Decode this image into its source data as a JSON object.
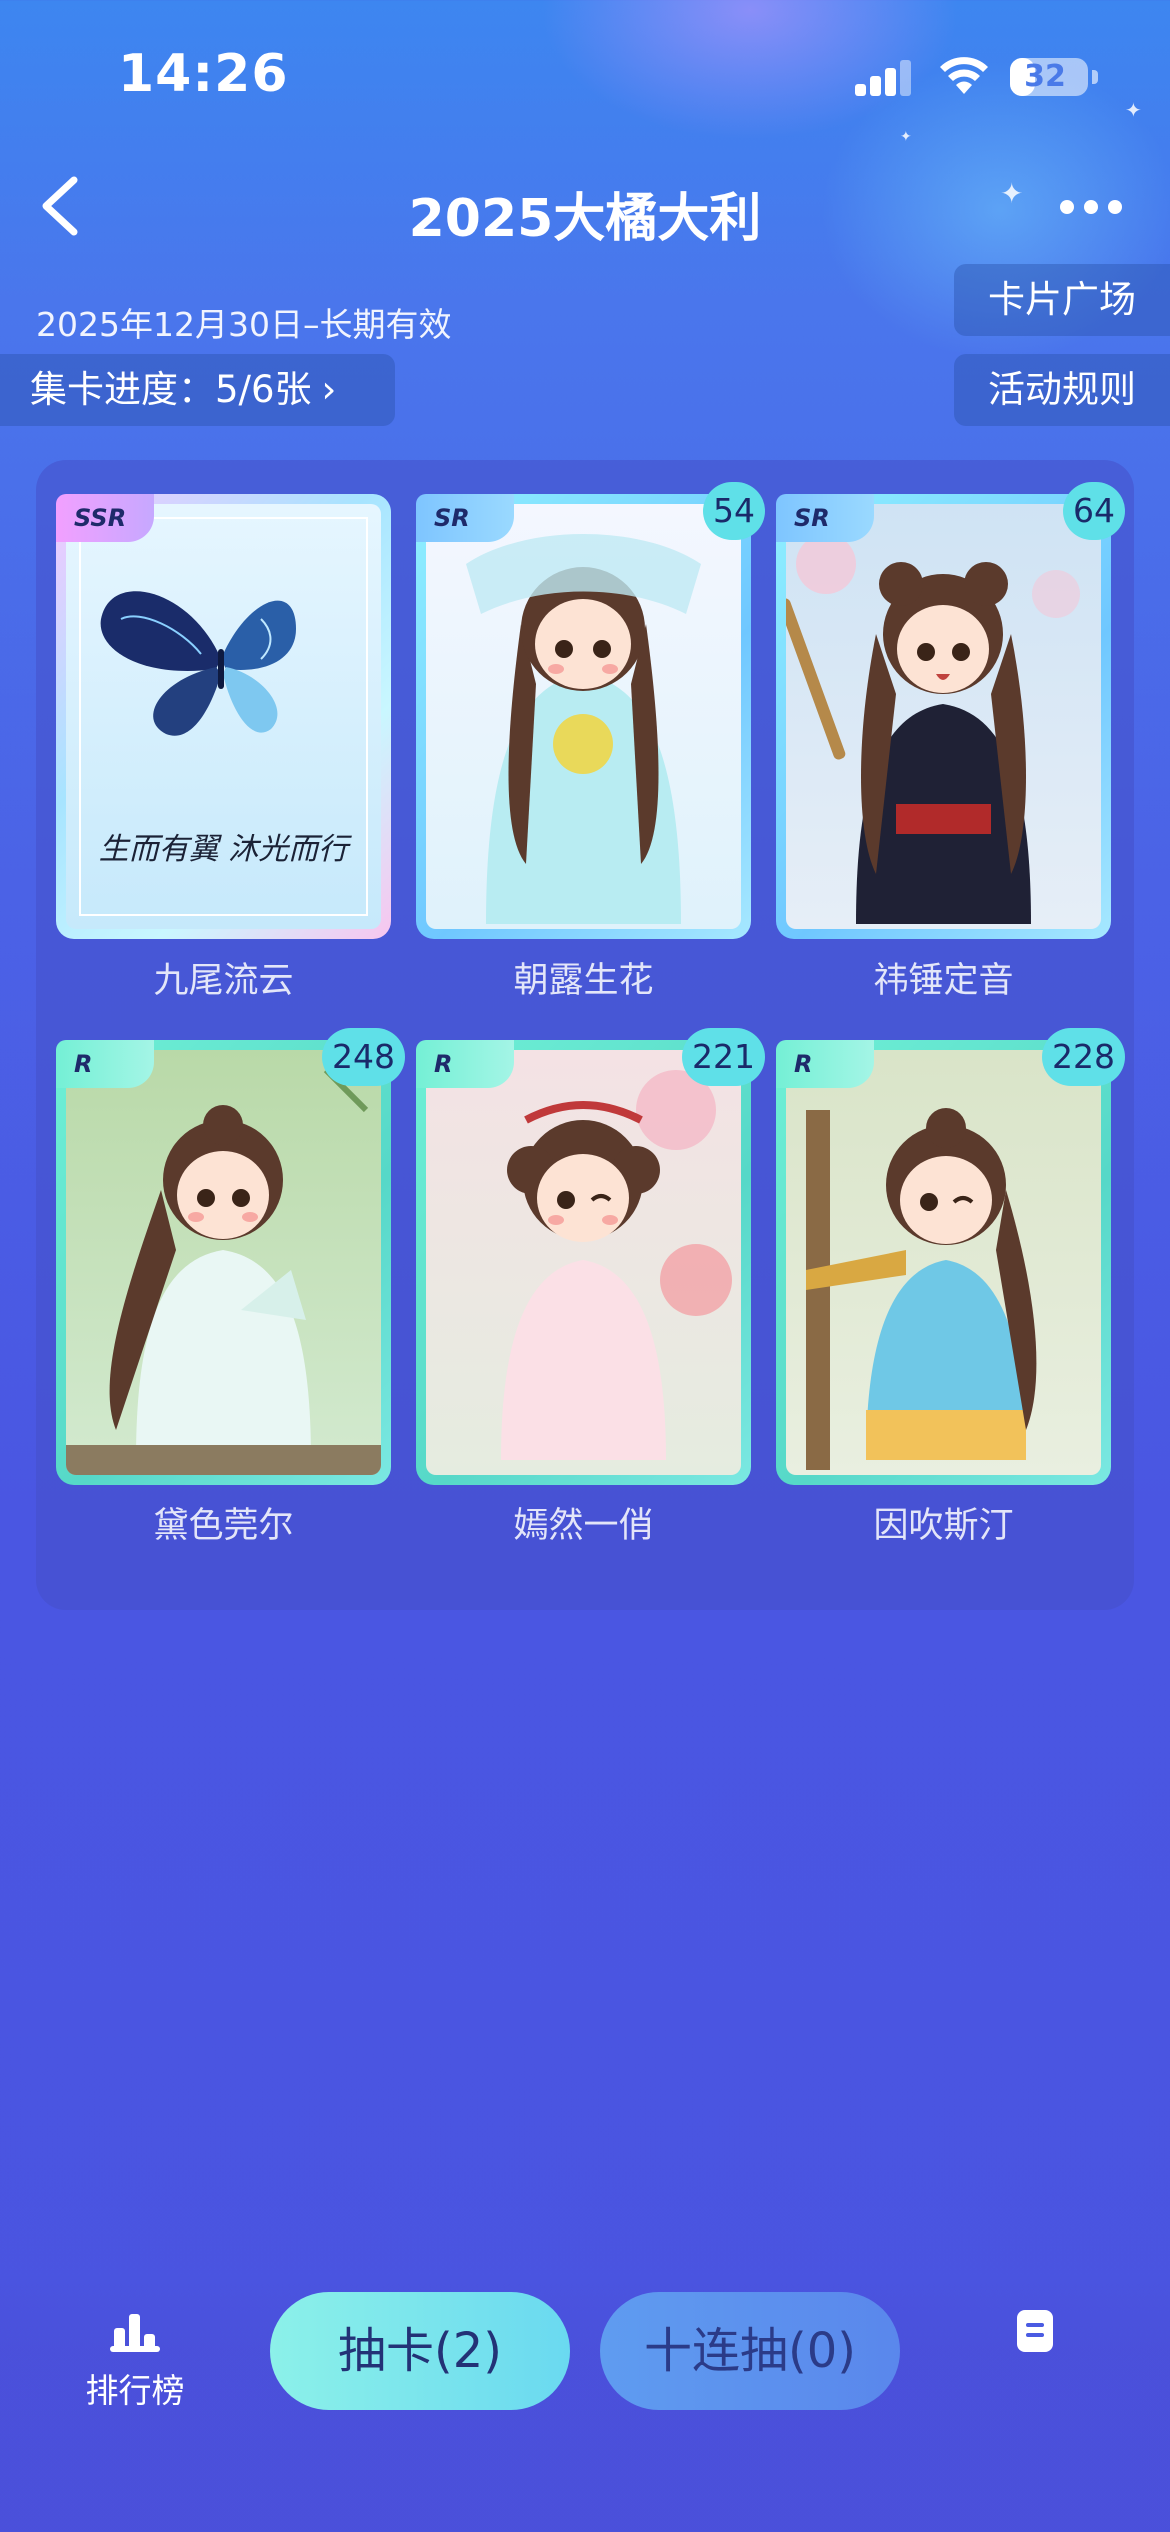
{
  "status_bar": {
    "time": "14:26",
    "battery": "32",
    "battery_level": 0.32
  },
  "nav": {
    "title": "2025大橘大利",
    "back_icon": "chevron-left-icon",
    "more_icon": "ellipsis-icon"
  },
  "info": {
    "date_range": "2025年12月30日–长期有效",
    "progress_label": "集卡进度：5/6张",
    "progress_arrow": "›",
    "card_square_button": "卡片广场",
    "rules_button": "活动规则"
  },
  "cards": [
    {
      "name": "九尾流云",
      "rarity": "SSR",
      "count": "",
      "caption": "生而有翼 沐光而行"
    },
    {
      "name": "朝露生花",
      "rarity": "SR",
      "count": "54"
    },
    {
      "name": "祎锤定音",
      "rarity": "SR",
      "count": "64"
    },
    {
      "name": "黛色莞尔",
      "rarity": "R",
      "count": "248"
    },
    {
      "name": "嫣然一俏",
      "rarity": "R",
      "count": "221"
    },
    {
      "name": "因吹斯汀",
      "rarity": "R",
      "count": "228"
    }
  ],
  "bottom": {
    "rank_label": "排行榜",
    "rank_icon": "bar-chart-icon",
    "draw_button": "抽卡(2)",
    "ten_draw_button": "十连抽(0)",
    "doc_icon": "document-icon"
  },
  "colors": {
    "accent": "#6ad9f0",
    "badge": "#5fe0e8",
    "bg_top": "#3d86f0",
    "bg_bottom": "#4a54e0"
  }
}
